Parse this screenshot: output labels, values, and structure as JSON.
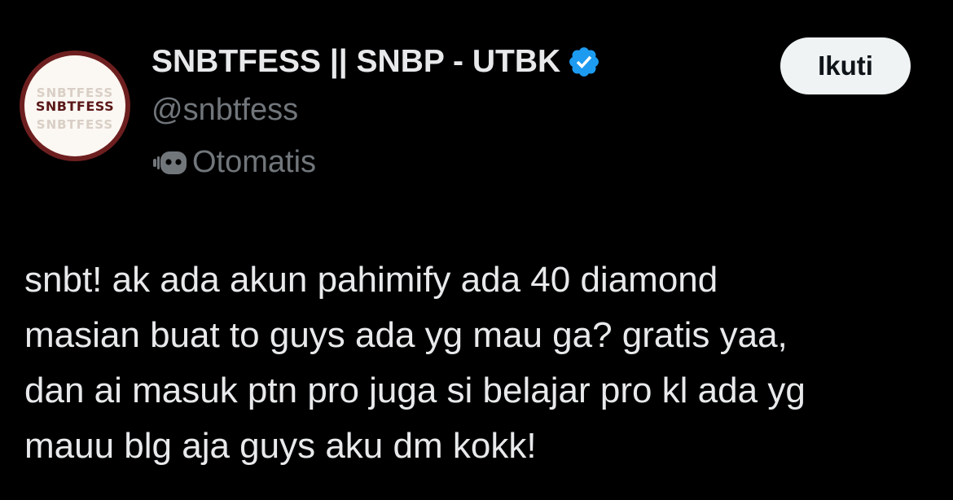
{
  "author": {
    "avatar_text": "SNBTFESS",
    "display_name": "SNBTFESS || SNBP - UTBK",
    "handle": "@snbtfess",
    "verified": true,
    "automated_label": "Otomatis"
  },
  "actions": {
    "follow_label": "Ikuti"
  },
  "tweet": {
    "lines": [
      "snbt! ak ada akun pahimify ada 40 diamond",
      "masian buat to guys ada yg mau ga? gratis yaa,",
      "dan ai masuk ptn pro juga si belajar pro kl ada yg",
      "mauu blg aja guys aku dm kokk!"
    ]
  },
  "colors": {
    "background": "#000000",
    "primary_text": "#e7e9ea",
    "secondary_text": "#71767b",
    "verified_badge": "#1d9bf0",
    "follow_button_bg": "#eff3f4",
    "follow_button_text": "#0f1419",
    "avatar_ring": "#6d1f1f",
    "avatar_bg": "#fbf7f2"
  },
  "icons": {
    "verified": "verified-badge-icon",
    "automated": "bot-icon"
  }
}
